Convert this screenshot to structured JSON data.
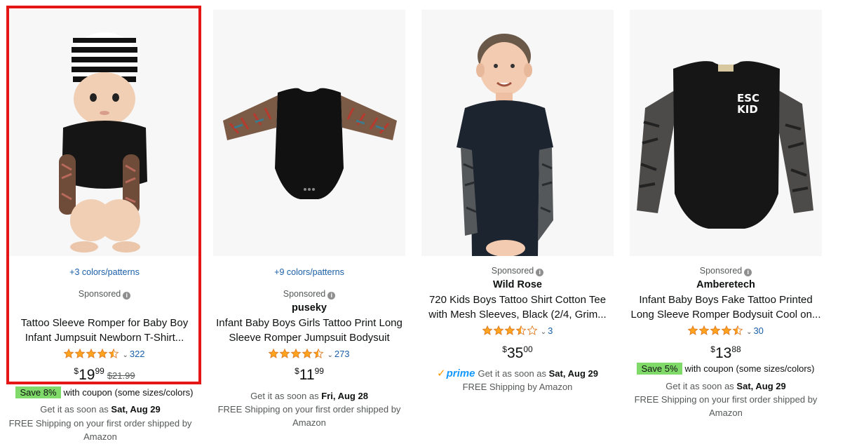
{
  "products": [
    {
      "variants": "+3 colors/patterns",
      "sponsored": "Sponsored",
      "brand": "",
      "title_line1": "Tattoo Sleeve Romper for Baby Boy",
      "title_line2": "Infant Jumpsuit Newborn T-Shirt...",
      "rating": 4.5,
      "review_count": "322",
      "price_symbol": "$",
      "price_whole": "19",
      "price_fraction": "99",
      "list_price": "$21.99",
      "coupon_badge": "Save 8%",
      "coupon_text": "with coupon (some sizes/colors)",
      "delivery_prefix": "Get it as soon as ",
      "delivery_date": "Sat, Aug 29",
      "shipping_line1": "FREE Shipping on your first order shipped by",
      "shipping_line2": "Amazon",
      "image": "baby-in-striped-beanie-tattoo-sleeve-romper"
    },
    {
      "variants": "+9 colors/patterns",
      "sponsored": "Sponsored",
      "brand": "puseky",
      "title_line1": "Infant Baby Boys Girls Tattoo Print Long",
      "title_line2": "Sleeve Romper Jumpsuit Bodysuit",
      "rating": 4.5,
      "review_count": "273",
      "price_symbol": "$",
      "price_whole": "11",
      "price_fraction": "99",
      "delivery_prefix": "Get it as soon as ",
      "delivery_date": "Fri, Aug 28",
      "shipping_line1": "FREE Shipping on your first order shipped by",
      "shipping_line2": "Amazon",
      "image": "black-romper-tattoo-sleeves"
    },
    {
      "sponsored": "Sponsored",
      "brand": "Wild Rose",
      "title_line1": "720 Kids Boys Tattoo Shirt Cotton Tee",
      "title_line2": "with Mesh Sleeves, Black (2/4, Grim...",
      "rating": 3.5,
      "review_count": "3",
      "price_symbol": "$",
      "price_whole": "35",
      "price_fraction": "00",
      "prime_label": "prime",
      "delivery_prefix": "Get it as soon as ",
      "delivery_date": "Sat, Aug 29",
      "shipping_line1": "FREE Shipping by Amazon",
      "image": "boy-black-tee-tattoo-sleeves"
    },
    {
      "sponsored": "Sponsored",
      "brand": "Amberetech",
      "title_line1": "Infant Baby Boys Fake Tattoo Printed",
      "title_line2": "Long Sleeve Romper Bodysuit Cool on...",
      "rating": 4.5,
      "review_count": "30",
      "price_symbol": "$",
      "price_whole": "13",
      "price_fraction": "88",
      "coupon_badge": "Save 5%",
      "coupon_text": "with coupon (some sizes/colors)",
      "delivery_prefix": "Get it as soon as ",
      "delivery_date": "Sat, Aug 29",
      "shipping_line1": "FREE Shipping on your first order shipped by",
      "shipping_line2": "Amazon",
      "image": "esc-kid-romper-tattoo-sleeves",
      "image_print": "ESC KID"
    }
  ],
  "colors": {
    "star": "#ffa41c",
    "link": "#1a5fa8",
    "highlight": "#e51616",
    "coupon": "#7fda69",
    "prime": "#1399ff"
  }
}
